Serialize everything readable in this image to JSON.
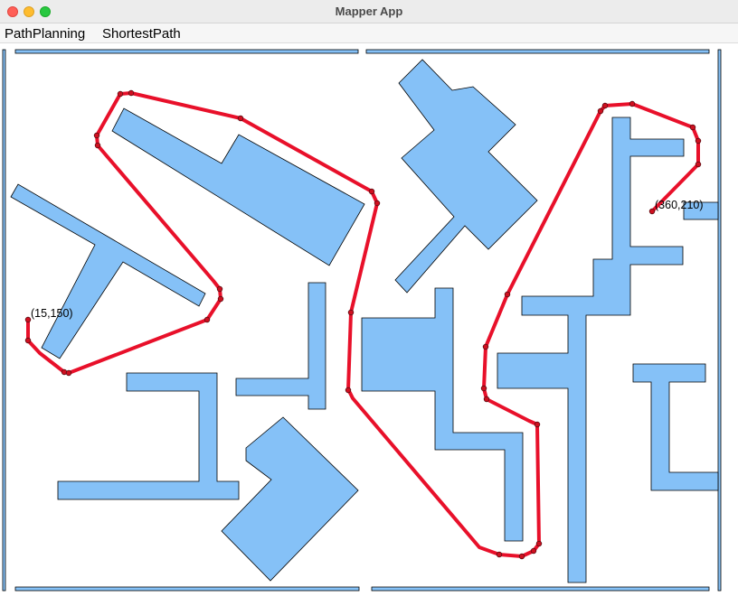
{
  "window": {
    "title": "Mapper App"
  },
  "menu": {
    "items": [
      "PathPlanning",
      "ShortestPath"
    ]
  },
  "map": {
    "obstacle_fill": "#85c1f7",
    "obstacle_stroke": "#000000",
    "path_color": "#e8102a",
    "start_label": "(15,150)",
    "goal_label": "(360,210)"
  }
}
